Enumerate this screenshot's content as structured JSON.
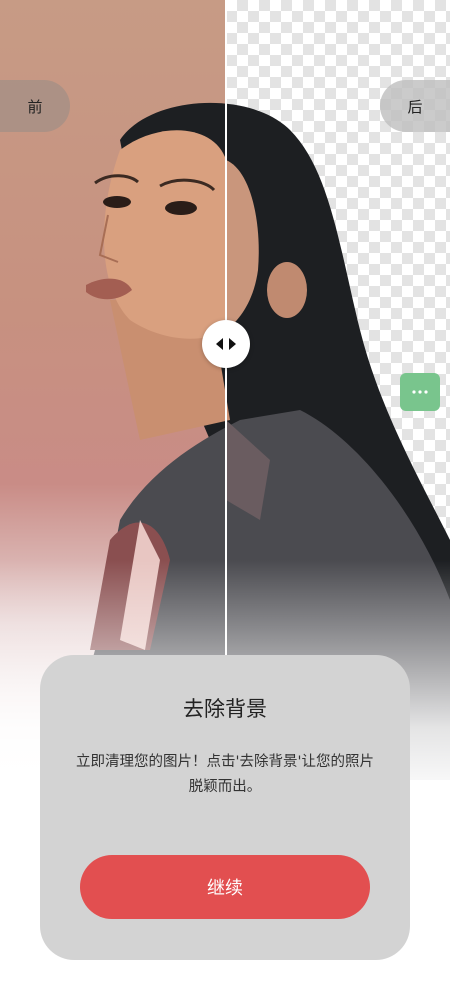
{
  "compare": {
    "before_label": "前",
    "after_label": "后",
    "handle_icon": "left-right-arrows-icon",
    "more_icon": "more-dots-icon"
  },
  "card": {
    "title": "去除背景",
    "description": "立即清理您的图片！点击'去除背景'让您的照片脱颖而出。",
    "continue_label": "继续"
  },
  "colors": {
    "accent_button": "#e24f50",
    "more_button": "#79c58d",
    "card_background": "#d3d3d3"
  }
}
